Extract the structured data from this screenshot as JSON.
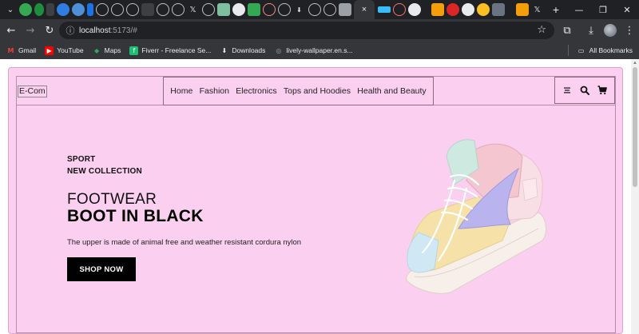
{
  "browser": {
    "active_tab_close": "×",
    "new_tab": "+",
    "url_host": "localhost",
    "url_path": ":5173/#",
    "bookmarks": [
      {
        "label": "Gmail",
        "icon": "gmail-icon",
        "color": "#ea4335"
      },
      {
        "label": "YouTube",
        "icon": "youtube-icon",
        "color": "#ff0000"
      },
      {
        "label": "Maps",
        "icon": "maps-icon",
        "color": "#34a853"
      },
      {
        "label": "Fiverr - Freelance Se...",
        "icon": "fiverr-icon",
        "color": "#1dbf73"
      },
      {
        "label": "Downloads",
        "icon": "download-icon",
        "color": "#e8eaed"
      },
      {
        "label": "lively-wallpaper.en.s...",
        "icon": "globe-icon",
        "color": "#9aa0a6"
      }
    ],
    "all_bookmarks": "All Bookmarks"
  },
  "site": {
    "logo": "E-Com",
    "nav": [
      "Home",
      "Fashion",
      "Electronics",
      "Tops and Hoodies",
      "Health and Beauty"
    ],
    "hero": {
      "line1": "SPORT",
      "line2": "NEW COLLECTION",
      "category": "FOOTWEAR",
      "title": "BOOT IN BLACK",
      "description": "The upper is made of animal free and weather resistant cordura nylon",
      "cta": "SHOP NOW"
    }
  },
  "colors": {
    "page_bg": "#fbcff0",
    "button_bg": "#000000",
    "browser_dark": "#202124",
    "browser_toolbar": "#35363a"
  }
}
